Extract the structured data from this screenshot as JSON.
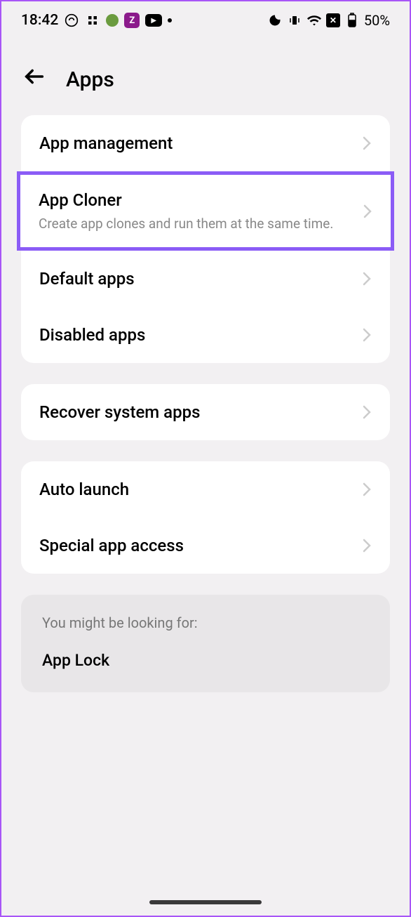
{
  "status_bar": {
    "time": "18:42",
    "battery_percent": "50%"
  },
  "header": {
    "title": "Apps"
  },
  "groups": [
    {
      "items": [
        {
          "title": "App management",
          "highlighted": false
        },
        {
          "title": "App Cloner",
          "subtitle": "Create app clones and run them at the same time.",
          "highlighted": true
        },
        {
          "title": "Default apps",
          "highlighted": false
        },
        {
          "title": "Disabled apps",
          "highlighted": false
        }
      ]
    },
    {
      "items": [
        {
          "title": "Recover system apps",
          "highlighted": false
        }
      ]
    },
    {
      "items": [
        {
          "title": "Auto launch",
          "highlighted": false
        },
        {
          "title": "Special app access",
          "highlighted": false
        }
      ]
    }
  ],
  "suggestion": {
    "header": "You might be looking for:",
    "item": "App Lock"
  }
}
